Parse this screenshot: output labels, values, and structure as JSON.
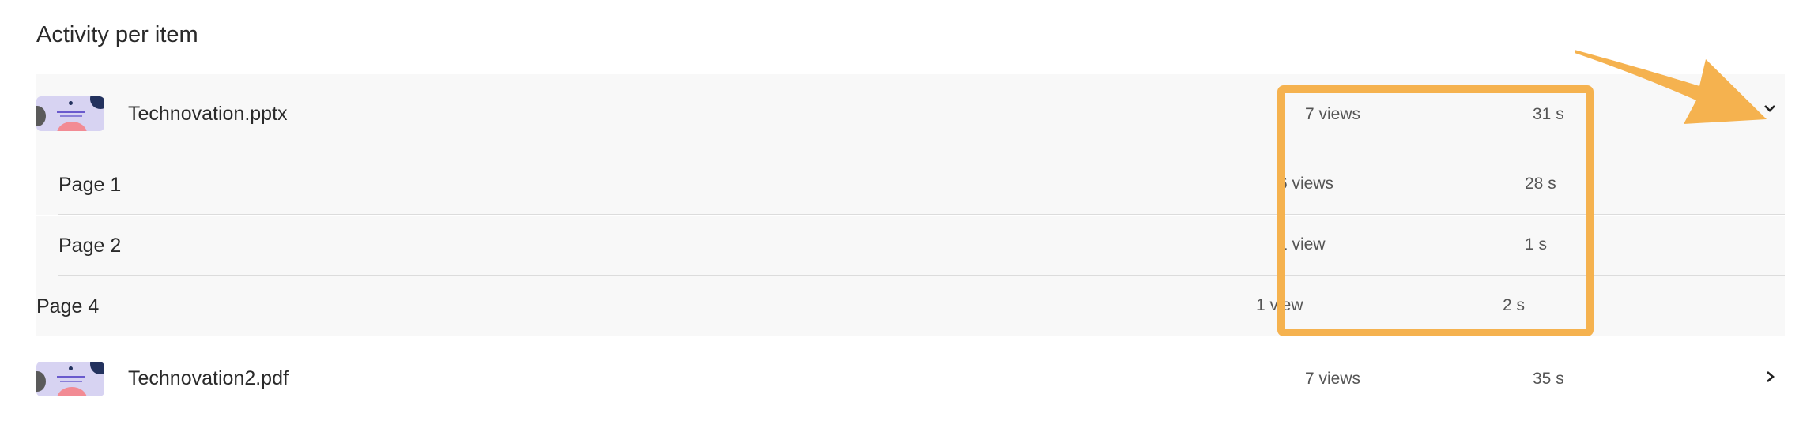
{
  "section_title": "Activity per item",
  "items": [
    {
      "name": "Technovation.pptx",
      "views": "7 views",
      "time": "31 s",
      "expanded": true,
      "pages": [
        {
          "name": "Page 1",
          "views": "6 views",
          "time": "28 s"
        },
        {
          "name": "Page 2",
          "views": "1 view",
          "time": "1 s"
        },
        {
          "name": "Page 4",
          "views": "1 view",
          "time": "2 s"
        }
      ]
    },
    {
      "name": "Technovation2.pdf",
      "views": "7 views",
      "time": "35 s",
      "expanded": false
    }
  ],
  "icons": {
    "expanded_chevron": "chevron-down-icon",
    "collapsed_chevron": "chevron-right-icon"
  },
  "colors": {
    "highlight": "#f5b24f",
    "row_bg": "#f8f8f8",
    "divider": "#dcdcdc"
  }
}
